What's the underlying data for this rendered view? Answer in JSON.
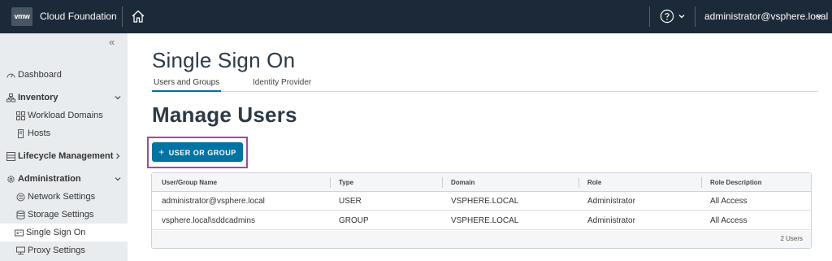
{
  "header": {
    "logo_text": "vmw",
    "app_name": "Cloud Foundation",
    "user": "administrator@vsphere.local"
  },
  "sidebar": {
    "items": [
      {
        "label": "Dashboard"
      },
      {
        "label": "Inventory"
      },
      {
        "label": "Workload Domains"
      },
      {
        "label": "Hosts"
      },
      {
        "label": "Lifecycle Management"
      },
      {
        "label": "Administration"
      },
      {
        "label": "Network Settings"
      },
      {
        "label": "Storage Settings"
      },
      {
        "label": "Single Sign On"
      },
      {
        "label": "Proxy Settings"
      }
    ],
    "active": "Single Sign On"
  },
  "page": {
    "title": "Single Sign On",
    "tabs": [
      {
        "label": "Users and Groups",
        "active": true
      },
      {
        "label": "Identity Provider",
        "active": false
      }
    ],
    "section_title": "Manage Users",
    "add_button_label": "USER OR GROUP"
  },
  "table": {
    "columns": [
      "User/Group Name",
      "Type",
      "Domain",
      "Role",
      "Role Description"
    ],
    "rows": [
      [
        "administrator@vsphere.local",
        "USER",
        "VSPHERE.LOCAL",
        "Administrator",
        "All Access"
      ],
      [
        "vsphere.local\\sddcadmins",
        "GROUP",
        "VSPHERE.LOCAL",
        "Administrator",
        "All Access"
      ]
    ],
    "footer": "2 Users"
  },
  "colors": {
    "header_bg": "#1c2938",
    "sidebar_bg": "#e9ecef",
    "primary": "#0072a3",
    "highlight_outline": "#9b4aa8"
  }
}
